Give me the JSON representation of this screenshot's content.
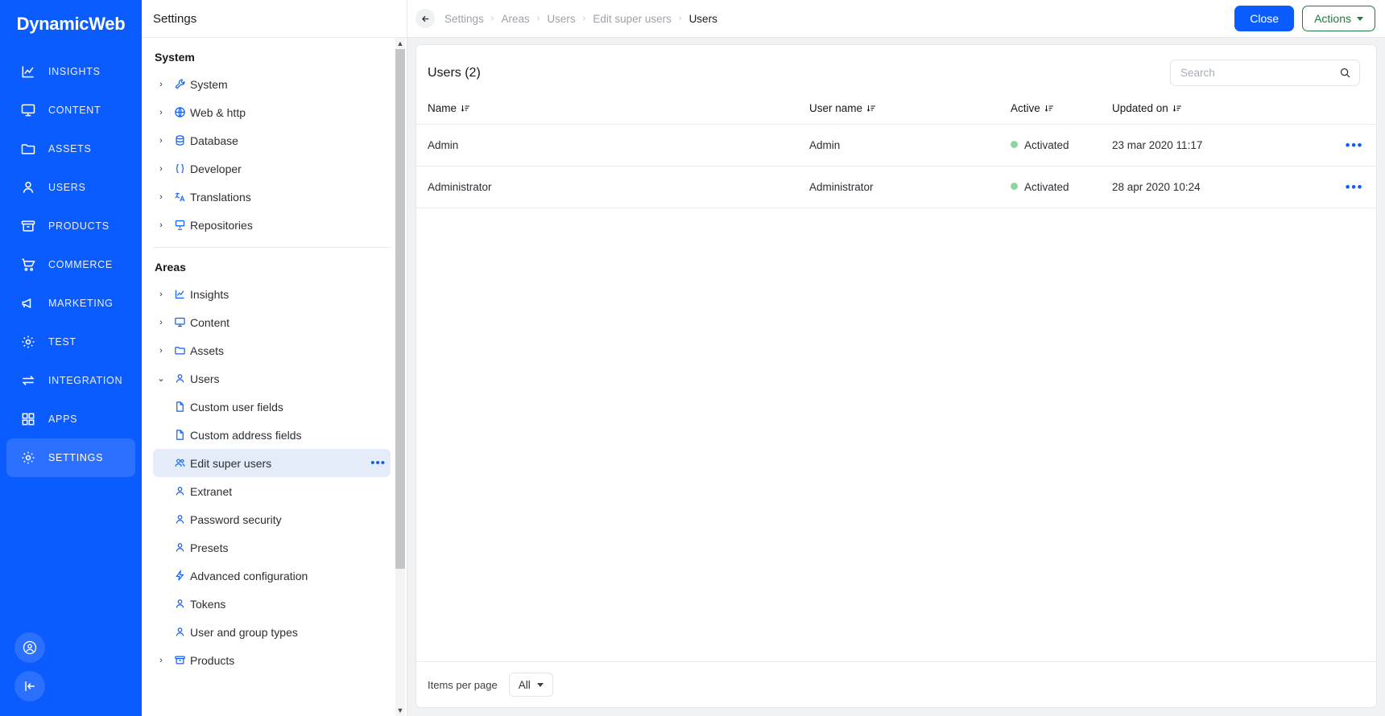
{
  "brand": {
    "name": "DynamicWeb"
  },
  "rail": {
    "items": [
      {
        "label": "INSIGHTS",
        "icon": "chart-line-icon",
        "active": false
      },
      {
        "label": "CONTENT",
        "icon": "monitor-icon",
        "active": false
      },
      {
        "label": "ASSETS",
        "icon": "folder-icon",
        "active": false
      },
      {
        "label": "USERS",
        "icon": "user-icon",
        "active": false
      },
      {
        "label": "PRODUCTS",
        "icon": "box-icon",
        "active": false
      },
      {
        "label": "COMMERCE",
        "icon": "cart-icon",
        "active": false
      },
      {
        "label": "MARKETING",
        "icon": "megaphone-icon",
        "active": false
      },
      {
        "label": "TEST",
        "icon": "gear-icon",
        "active": false
      },
      {
        "label": "INTEGRATION",
        "icon": "exchange-icon",
        "active": false
      },
      {
        "label": "APPS",
        "icon": "grid-icon",
        "active": false
      },
      {
        "label": "SETTINGS",
        "icon": "gear-icon",
        "active": true
      }
    ],
    "bottom": [
      {
        "icon": "account-circle-icon"
      },
      {
        "icon": "collapse-sidebar-icon"
      }
    ]
  },
  "settings_panel": {
    "title": "Settings",
    "groups": [
      {
        "title": "System",
        "items": [
          {
            "label": "System",
            "icon": "wrench-icon",
            "expandable": true
          },
          {
            "label": "Web & http",
            "icon": "globe-icon",
            "expandable": true
          },
          {
            "label": "Database",
            "icon": "database-icon",
            "expandable": true
          },
          {
            "label": "Developer",
            "icon": "braces-icon",
            "expandable": true
          },
          {
            "label": "Translations",
            "icon": "translate-icon",
            "expandable": true
          },
          {
            "label": "Repositories",
            "icon": "server-icon",
            "expandable": true
          }
        ]
      },
      {
        "title": "Areas",
        "items": [
          {
            "label": "Insights",
            "icon": "chart-line-icon",
            "expandable": true
          },
          {
            "label": "Content",
            "icon": "monitor-icon",
            "expandable": true
          },
          {
            "label": "Assets",
            "icon": "folder-icon",
            "expandable": true
          },
          {
            "label": "Users",
            "icon": "users-icon",
            "expandable": true,
            "expanded": true
          },
          {
            "label": "Custom user fields",
            "icon": "file-icon",
            "child": true
          },
          {
            "label": "Custom address fields",
            "icon": "file-icon",
            "child": true
          },
          {
            "label": "Edit super users",
            "icon": "users-icon",
            "child": true,
            "selected": true,
            "menu": "•••"
          },
          {
            "label": "Extranet",
            "icon": "user-icon",
            "child": true
          },
          {
            "label": "Password security",
            "icon": "user-icon",
            "child": true
          },
          {
            "label": "Presets",
            "icon": "user-icon",
            "child": true
          },
          {
            "label": "Advanced configuration",
            "icon": "bolt-icon",
            "child": true
          },
          {
            "label": "Tokens",
            "icon": "user-icon",
            "child": true
          },
          {
            "label": "User and group types",
            "icon": "user-icon",
            "child": true
          },
          {
            "label": "Products",
            "icon": "box-icon",
            "expandable": true
          }
        ]
      }
    ]
  },
  "topbar": {
    "breadcrumb": [
      "Settings",
      "Areas",
      "Users",
      "Edit super users",
      "Users"
    ],
    "separator": "›",
    "close_label": "Close",
    "actions_label": "Actions"
  },
  "main": {
    "card_title": "Users (2)",
    "search": {
      "placeholder": "Search",
      "value": ""
    },
    "table": {
      "columns": [
        "Name",
        "User name",
        "Active",
        "Updated on"
      ],
      "rows": [
        {
          "name": "Admin",
          "user_name": "Admin",
          "active": "Activated",
          "updated_on": "23 mar 2020 11:17",
          "menu": "•••"
        },
        {
          "name": "Administrator",
          "user_name": "Administrator",
          "active": "Activated",
          "updated_on": "28 apr 2020 10:24",
          "menu": "•••"
        }
      ]
    },
    "footer": {
      "items_per_page_label": "Items per page",
      "items_per_page_value": "All"
    }
  },
  "colors": {
    "brand_blue": "#0b5cff",
    "accent_green": "#1d7a3d",
    "status_green": "#8ed6a0",
    "selected_bg": "#e4ecf9"
  }
}
